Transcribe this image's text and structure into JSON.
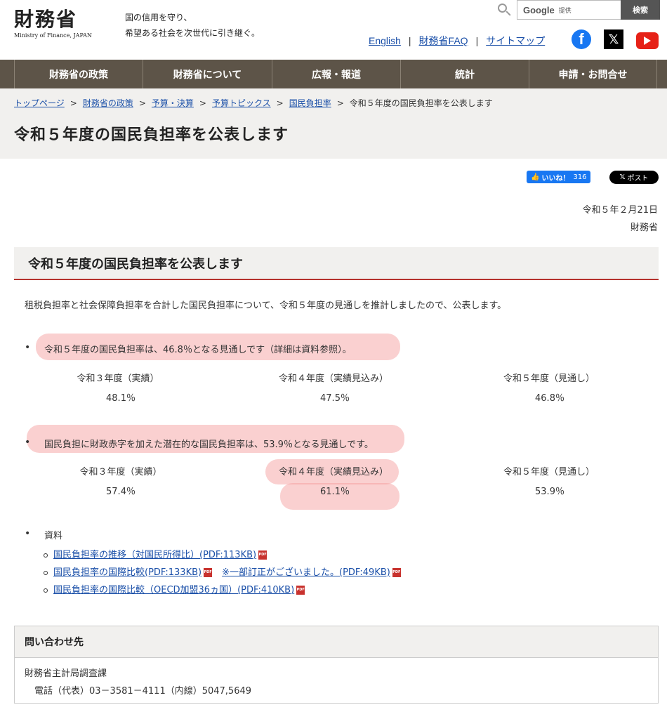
{
  "header": {
    "logo_main": "財務省",
    "logo_sub": "Ministry of Finance, JAPAN",
    "tagline_line1": "国の信用を守り、",
    "tagline_line2": "希望ある社会を次世代に引き継ぐ。",
    "search": {
      "provider": "Google",
      "provider_suffix": "提供",
      "button_label": "検索"
    },
    "links": {
      "english": "English",
      "faq": "財務省FAQ",
      "sitemap": "サイトマップ",
      "separator": "|"
    },
    "social": {
      "facebook": "facebook-icon",
      "x": "x-icon",
      "youtube": "youtube-icon"
    }
  },
  "nav": {
    "items": [
      {
        "label": "財務省の政策"
      },
      {
        "label": "財務省について"
      },
      {
        "label": "広報・報道"
      },
      {
        "label": "統計"
      },
      {
        "label": "申請・お問合せ"
      }
    ]
  },
  "breadcrumb": {
    "items": [
      "トップページ",
      "財務省の政策",
      "予算・決算",
      "予算トピックス",
      "国民負担率"
    ],
    "current": "令和５年度の国民負担率を公表します",
    "separator": ">"
  },
  "page_title": "令和５年度の国民負担率を公表します",
  "share": {
    "like_label": "いいね！",
    "like_count": "316",
    "post_label": "ポスト"
  },
  "meta": {
    "date": "令和５年２月21日",
    "publisher": "財務省"
  },
  "section_heading": "令和５年度の国民負担率を公表します",
  "intro": "租税負担率と社会保障負担率を合計した国民負担率について、令和５年度の見通しを推計しましたので、公表します。",
  "burden": {
    "text": "令和５年度の国民負担率は、46.8％となる見通しです（詳細は資料参照）。",
    "columns": [
      {
        "label": "令和３年度（実績）",
        "value": "48.1％"
      },
      {
        "label": "令和４年度（実績見込み）",
        "value": "47.5％"
      },
      {
        "label": "令和５年度（見通し）",
        "value": "46.8％"
      }
    ]
  },
  "potential": {
    "text": "国民負担に財政赤字を加えた潜在的な国民負担率は、53.9％となる見通しです。",
    "columns": [
      {
        "label": "令和３年度（実績）",
        "value": "57.4％"
      },
      {
        "label": "令和４年度（実績見込み）",
        "value": "61.1％"
      },
      {
        "label": "令和５年度（見通し）",
        "value": "53.9％"
      }
    ]
  },
  "materials": {
    "label": "資料",
    "items": [
      {
        "text": "国民負担率の推移（対国民所得比）(PDF:113KB)"
      },
      {
        "text": "国民負担率の国際比較(PDF:133KB)",
        "extra": "※一部訂正がございました。(PDF:49KB)"
      },
      {
        "text": "国民負担率の国際比較（OECD加盟36ヵ国）(PDF:410KB)"
      }
    ],
    "pdf_icon_label": "PDF"
  },
  "contact": {
    "heading": "問い合わせ先",
    "department": "財務省主計局調査課",
    "phone": "電話（代表）03－3581－4111（内線）5047,5649"
  },
  "colors": {
    "nav_bg": "#5d5448",
    "accent_red": "#b5322e",
    "highlight": "#f4a0a0",
    "link": "#1a4fa8"
  }
}
